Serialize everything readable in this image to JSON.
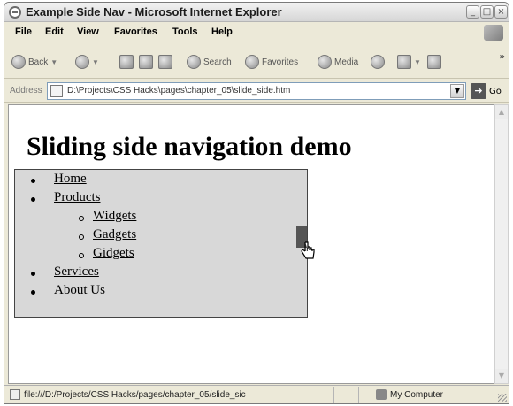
{
  "window": {
    "title": "Example Side Nav - Microsoft Internet Explorer",
    "controls": {
      "minimize": "_",
      "maximize": "□",
      "close": "×"
    }
  },
  "menubar": {
    "items": [
      "File",
      "Edit",
      "View",
      "Favorites",
      "Tools",
      "Help"
    ]
  },
  "toolbar": {
    "back_label": "Back",
    "search_label": "Search",
    "favorites_label": "Favorites",
    "media_label": "Media",
    "more": "»"
  },
  "address": {
    "label": "Address",
    "url": "D:\\Projects\\CSS Hacks\\pages\\chapter_05\\slide_side.htm",
    "go_label": "Go"
  },
  "page": {
    "heading": "Sliding side navigation demo",
    "nav": {
      "items": [
        {
          "label": "Home"
        },
        {
          "label": "Products",
          "children": [
            "Widgets",
            "Gadgets",
            "Gidgets"
          ]
        },
        {
          "label": "Services"
        },
        {
          "label": "About Us"
        }
      ]
    }
  },
  "statusbar": {
    "text": "file:///D:/Projects/CSS Hacks/pages/chapter_05/slide_sic",
    "zone": "My Computer"
  }
}
